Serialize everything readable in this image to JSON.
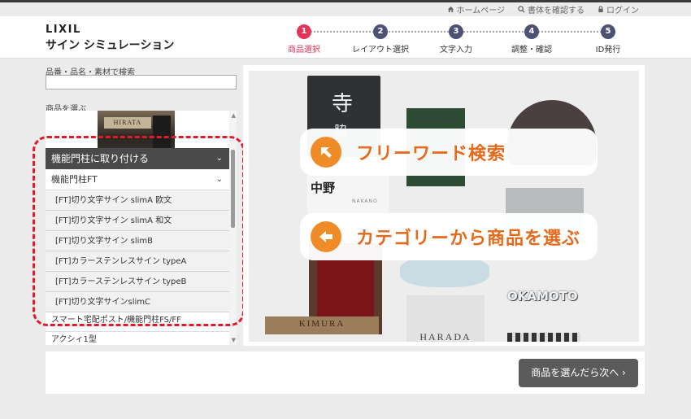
{
  "utility_nav": {
    "home": "ホームページ",
    "catalog": "書体を確認する",
    "login": "ログイン"
  },
  "header": {
    "logo": "LIXIL",
    "title": "サイン シミュレーション"
  },
  "steps": [
    {
      "num": "1",
      "label": "商品選択",
      "active": true
    },
    {
      "num": "2",
      "label": "レイアウト選択",
      "active": false
    },
    {
      "num": "3",
      "label": "文字入力",
      "active": false
    },
    {
      "num": "4",
      "label": "調整・確認",
      "active": false
    },
    {
      "num": "5",
      "label": "ID発行",
      "active": false
    }
  ],
  "search": {
    "label": "品番・品名・素材で検索",
    "value": ""
  },
  "category": {
    "label": "商品を選ぶ",
    "thumb_text": "HIRATA",
    "group_head": "機能門柱に取り付ける",
    "sub_head": "機能門柱FT",
    "items": [
      "[FT]切り文字サイン slimA 欧文",
      "[FT]切り文字サイン slimA 和文",
      "[FT]切り文字サイン slimB",
      "[FT]カラーステンレスサイン typeA",
      "[FT]カラーステンレスサイン typeB",
      "[FT]切り文字サインslimC"
    ],
    "more_items": [
      "スマート宅配ポスト/機能門柱FS/FF",
      "アクシィ1型"
    ]
  },
  "hero": {
    "callout_search": "フリーワード検索",
    "callout_category": "カテゴリーから商品を選ぶ",
    "sample_texts": [
      "寺",
      "脇",
      "中野",
      "NAKANO",
      "KIMURA",
      "HARADA",
      "OKAMOTO"
    ]
  },
  "footer": {
    "next_label": "商品を選んだら次へ ›"
  },
  "colors": {
    "accent_pink": "#e33457",
    "step_navy": "#4d5274",
    "callout_orange": "#f08c28",
    "highlight_red": "#e11a2c"
  }
}
